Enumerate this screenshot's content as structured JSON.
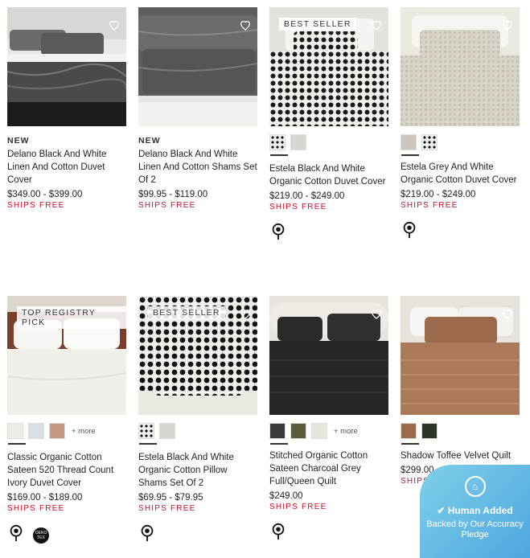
{
  "products": [
    {
      "flag": "NEW",
      "badge": "",
      "title": "Delano Black And White Linen And Cotton Duvet Cover",
      "price": "$349.00 - $399.00",
      "ships": "SHIPS FREE",
      "swatches": [],
      "more": "",
      "certs": []
    },
    {
      "flag": "NEW",
      "badge": "",
      "title": "Delano Black And White Linen And Cotton Shams Set Of 2",
      "price": "$99.95 - $119.00",
      "ships": "SHIPS FREE",
      "swatches": [],
      "more": "",
      "certs": []
    },
    {
      "flag": "",
      "badge": "BEST SELLER",
      "title": "Estela Black And White Organic Cotton Duvet Cover",
      "price": "$219.00 - $249.00",
      "ships": "SHIPS FREE",
      "swatches": [
        "#222",
        "#d8d6cf"
      ],
      "more": "",
      "certs": [
        "cotton-icon"
      ]
    },
    {
      "flag": "",
      "badge": "",
      "title": "Estela Grey And White Organic Cotton Duvet Cover",
      "price": "$219.00 - $249.00",
      "ships": "SHIPS FREE",
      "swatches": [
        "#cbc6bb",
        "#222"
      ],
      "more": "",
      "certs": [
        "cotton-icon"
      ]
    },
    {
      "flag": "",
      "badge": "TOP REGISTRY PICK",
      "title": "Classic Organic Cotton Sateen 520 Thread Count Ivory Duvet Cover",
      "price": "$169.00 - $189.00",
      "ships": "SHIPS FREE",
      "swatches": [
        "#efece6",
        "#d9dfe3",
        "#c59a83"
      ],
      "more": "+ more",
      "certs": [
        "cotton-icon",
        "oeko-tex-icon"
      ]
    },
    {
      "flag": "",
      "badge": "BEST SELLER",
      "title": "Estela Black And White Organic Cotton Pillow Shams Set Of 2",
      "price": "$69.95 - $79.95",
      "ships": "SHIPS FREE",
      "swatches": [
        "#222",
        "#d8d6cf"
      ],
      "more": "",
      "certs": [
        "cotton-icon"
      ]
    },
    {
      "flag": "",
      "badge": "",
      "title": "Stitched Organic Cotton Sateen Charcoal Grey Full/Queen Quilt",
      "price": "$249.00",
      "ships": "SHIPS FREE",
      "swatches": [
        "#3a3a3a",
        "#5c5b3c",
        "#e8e5dc"
      ],
      "more": "+ more",
      "certs": [
        "cotton-icon"
      ]
    },
    {
      "flag": "",
      "badge": "",
      "title": "Shadow Toffee Velvet Quilt",
      "price": "$299.00 - $349.00",
      "ships": "SHIPS FREE",
      "swatches": [
        "#9b6a4c",
        "#2c3526"
      ],
      "more": "",
      "certs": []
    }
  ],
  "oeko_label": "OEKO TEX",
  "widget": {
    "title": "Human Added",
    "subtitle": "Backed by Our Accuracy Pledge",
    "icon": "shield-icon"
  },
  "colors": {
    "ships": "#c8102e",
    "widget": "#4ea6e0"
  }
}
